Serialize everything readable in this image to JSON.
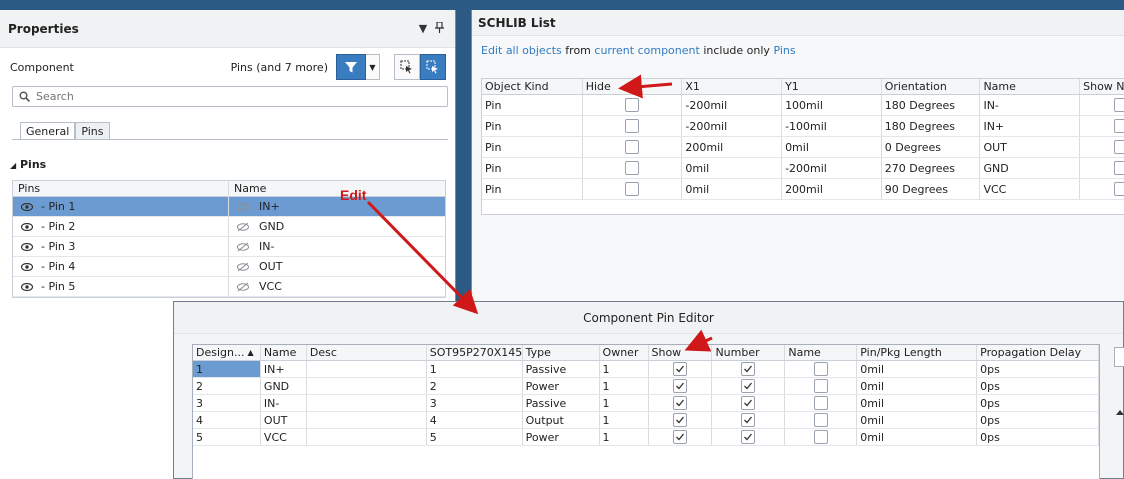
{
  "properties": {
    "title": "Properties",
    "component_label": "Component",
    "filter_text": "Pins (and 7 more)",
    "search_placeholder": "Search",
    "tabs": [
      "General",
      "Pins"
    ],
    "section_title": "Pins",
    "columns": [
      "Pins",
      "Name"
    ],
    "rows": [
      {
        "pin": "- Pin 1",
        "name": "IN+"
      },
      {
        "pin": "- Pin 2",
        "name": "GND"
      },
      {
        "pin": "- Pin 3",
        "name": "IN-"
      },
      {
        "pin": "- Pin 4",
        "name": "OUT"
      },
      {
        "pin": "- Pin 5",
        "name": "VCC"
      }
    ]
  },
  "schlib": {
    "title": "SCHLIB List",
    "filter": {
      "edit": "Edit",
      "all_objects": "all objects",
      "from": "from",
      "current_component": "current component",
      "include_only": "include only",
      "pins": "Pins"
    },
    "columns": [
      "Object Kind",
      "Hide",
      "X1",
      "Y1",
      "Orientation",
      "Name",
      "Show N"
    ],
    "rows": [
      {
        "kind": "Pin",
        "x1": "-200mil",
        "y1": "100mil",
        "orientation": "180 Degrees",
        "name": "IN-"
      },
      {
        "kind": "Pin",
        "x1": "-200mil",
        "y1": "-100mil",
        "orientation": "180 Degrees",
        "name": "IN+"
      },
      {
        "kind": "Pin",
        "x1": "200mil",
        "y1": "0mil",
        "orientation": "0 Degrees",
        "name": "OUT"
      },
      {
        "kind": "Pin",
        "x1": "0mil",
        "y1": "-200mil",
        "orientation": "270 Degrees",
        "name": "GND"
      },
      {
        "kind": "Pin",
        "x1": "0mil",
        "y1": "200mil",
        "orientation": "90 Degrees",
        "name": "VCC"
      }
    ]
  },
  "editor": {
    "title": "Component Pin Editor",
    "columns": [
      "Design...",
      "Name",
      "Desc",
      "SOT95P270X145...",
      "Type",
      "Owner",
      "Show",
      "Number",
      "Name",
      "Pin/Pkg Length",
      "Propagation Delay"
    ],
    "rows": [
      {
        "des": "1",
        "name": "IN+",
        "desc": "",
        "pkg": "1",
        "type": "Passive",
        "owner": "1",
        "length": "0mil",
        "delay": "0ps"
      },
      {
        "des": "2",
        "name": "GND",
        "desc": "",
        "pkg": "2",
        "type": "Power",
        "owner": "1",
        "length": "0mil",
        "delay": "0ps"
      },
      {
        "des": "3",
        "name": "IN-",
        "desc": "",
        "pkg": "3",
        "type": "Passive",
        "owner": "1",
        "length": "0mil",
        "delay": "0ps"
      },
      {
        "des": "4",
        "name": "OUT",
        "desc": "",
        "pkg": "4",
        "type": "Output",
        "owner": "1",
        "length": "0mil",
        "delay": "0ps"
      },
      {
        "des": "5",
        "name": "VCC",
        "desc": "",
        "pkg": "5",
        "type": "Power",
        "owner": "1",
        "length": "0mil",
        "delay": "0ps"
      }
    ]
  },
  "annotation": {
    "edit_label": "Edit",
    "color": "#d01818"
  },
  "colors": {
    "accent": "#3a7cc0",
    "selection": "#6c9bd1",
    "link": "#2f7bc4",
    "background": "#2b5a84"
  }
}
